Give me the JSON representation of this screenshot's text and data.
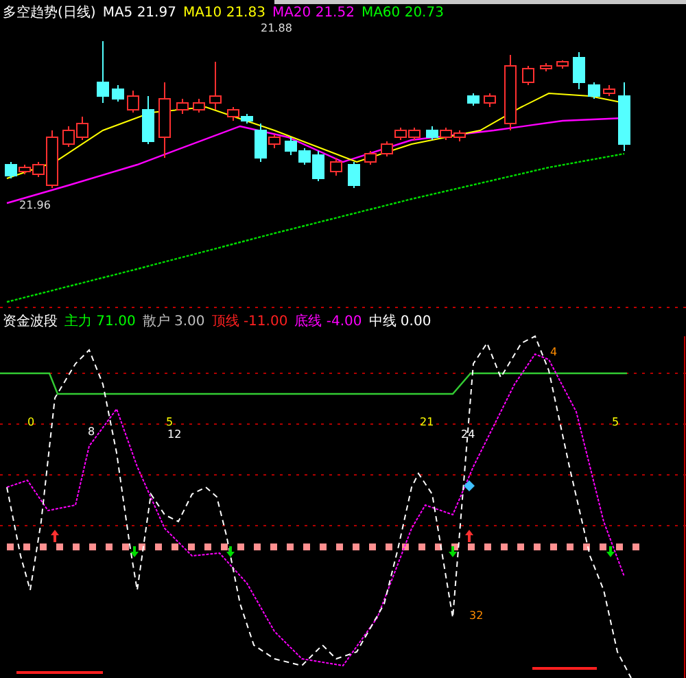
{
  "price_panel": {
    "title": "多空趋势(日线)",
    "legend": [
      {
        "label": "MA5 21.97",
        "color": "#ffffff"
      },
      {
        "label": "MA10 21.83",
        "color": "#ffff00"
      },
      {
        "label": "MA20 21.52",
        "color": "#ff00ff"
      },
      {
        "label": "MA60 20.73",
        "color": "#00ff00"
      }
    ],
    "high_label": "21.88",
    "low_label": "21.96"
  },
  "indicator_panel": {
    "title": "资金波段",
    "legend": [
      {
        "label": "主力 71.00",
        "color": "#00ff00"
      },
      {
        "label": "散户 3.00",
        "color": "#c0c0c0"
      },
      {
        "label": "顶线 -11.00",
        "color": "#ff2020"
      },
      {
        "label": "底线 -4.00",
        "color": "#ff00ff"
      },
      {
        "label": "中线 0.00",
        "color": "#ffffff"
      }
    ],
    "markers": [
      {
        "text": "0",
        "kind": "yellow"
      },
      {
        "text": "8",
        "kind": "white"
      },
      {
        "text": "5",
        "kind": "yellow"
      },
      {
        "text": "12",
        "kind": "white"
      },
      {
        "text": "21",
        "kind": "yellow"
      },
      {
        "text": "24",
        "kind": "white"
      },
      {
        "text": "5",
        "kind": "yellow"
      },
      {
        "text": "4",
        "kind": "orange"
      },
      {
        "text": "32",
        "kind": "orange"
      }
    ]
  }
}
